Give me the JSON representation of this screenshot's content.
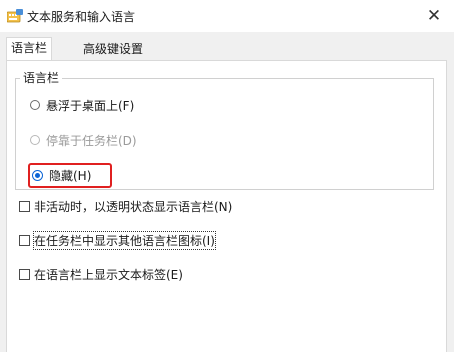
{
  "window": {
    "title": "文本服务和输入语言",
    "close_glyph": "✕"
  },
  "tabs": [
    {
      "label": "语言栏",
      "active": true
    },
    {
      "label": "高级键设置",
      "active": false
    }
  ],
  "language_bar_group": {
    "legend": "语言栏",
    "options": [
      {
        "label": "悬浮于桌面上(F)",
        "checked": false,
        "enabled": true
      },
      {
        "label": "停靠于任务栏(D)",
        "checked": false,
        "enabled": false
      },
      {
        "label": "隐藏(H)",
        "checked": true,
        "enabled": true,
        "highlighted": true
      }
    ]
  },
  "checkboxes": [
    {
      "label": "非活动时，以透明状态显示语言栏(N)",
      "checked": false
    },
    {
      "label": "在任务栏中显示其他语言栏图标(I)",
      "checked": false,
      "focused": true
    },
    {
      "label": "在语言栏上显示文本标签(E)",
      "checked": false
    }
  ],
  "colors": {
    "accent": "#0a64d6",
    "highlight": "#e02020",
    "dialog_bg": "#f0f0f0"
  },
  "icons": {
    "app": "keyboard-language-icon",
    "close": "close-icon"
  }
}
